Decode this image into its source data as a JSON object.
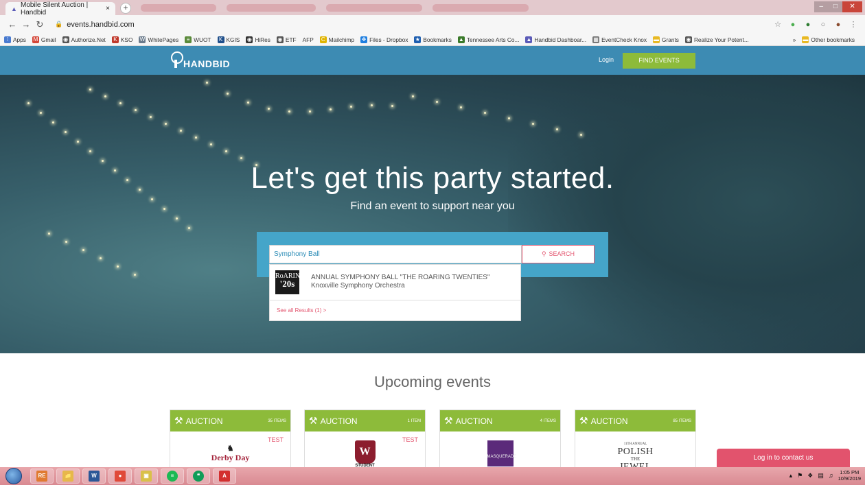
{
  "browser": {
    "active_tab_title": "Mobile Silent Auction | Handbid",
    "tab_close": "×",
    "new_tab": "+",
    "url": "events.handbid.com"
  },
  "bookmarks": [
    {
      "label": "Apps",
      "icon": "apps-grid-icon",
      "color": "#4a7bd0"
    },
    {
      "label": "Gmail",
      "icon": "gmail-icon",
      "color": "#d44638"
    },
    {
      "label": "Authorize.Net",
      "icon": "globe-icon",
      "color": "#555555"
    },
    {
      "label": "KSO",
      "icon": "kso-icon",
      "color": "#c0392b"
    },
    {
      "label": "WhitePages",
      "icon": "whitepages-icon",
      "color": "#6b7b8c"
    },
    {
      "label": "WUOT",
      "icon": "wuot-icon",
      "color": "#5a8a3a"
    },
    {
      "label": "KGIS",
      "icon": "kgis-icon",
      "color": "#1f4f8b"
    },
    {
      "label": "HiRes",
      "icon": "hires-icon",
      "color": "#333333"
    },
    {
      "label": "ETF",
      "icon": "globe-icon",
      "color": "#555555"
    },
    {
      "label": "AFP",
      "icon": "",
      "color": ""
    },
    {
      "label": "Mailchimp",
      "icon": "mailchimp-icon",
      "color": "#e0b400"
    },
    {
      "label": "Files - Dropbox",
      "icon": "dropbox-icon",
      "color": "#1f7fe0"
    },
    {
      "label": "Bookmarks",
      "icon": "star-icon",
      "color": "#1f5fb0"
    },
    {
      "label": "Tennessee Arts Co...",
      "icon": "tn-arts-icon",
      "color": "#3a7a2a"
    },
    {
      "label": "Handbid Dashboar...",
      "icon": "handbid-icon",
      "color": "#5b5bb8"
    },
    {
      "label": "EventCheck Knox",
      "icon": "calendar-icon",
      "color": "#777777"
    },
    {
      "label": "Grants",
      "icon": "folder-icon",
      "color": "#e8b923"
    },
    {
      "label": "Realize Your Potent...",
      "icon": "globe-icon",
      "color": "#555555"
    }
  ],
  "bookmarks_overflow": "»",
  "other_bookmarks": "Other bookmarks",
  "site": {
    "logo_text": "HANDBID",
    "login": "Login",
    "find_events": "FIND EVENTS"
  },
  "hero": {
    "title": "Let's get this party started.",
    "subtitle": "Find an event to support near you"
  },
  "search": {
    "value": "Symphony Ball",
    "button": "SEARCH",
    "result_thumb_line1": "RoARING",
    "result_thumb_line2": "'20s",
    "result_title": "ANNUAL SYMPHONY BALL \"THE ROARING TWENTIES\"",
    "result_org": "Knoxville Symphony Orchestra",
    "see_all": "See all Results (1) >"
  },
  "upcoming": {
    "title": "Upcoming events",
    "cards": [
      {
        "type": "AUCTION",
        "items": "35 ITEMS",
        "tag": "TEST",
        "logo": "Derby Day",
        "logo_glyph": "♞"
      },
      {
        "type": "AUCTION",
        "items": "1 ITEM",
        "tag": "TEST",
        "logo": "STUDENT",
        "logo_glyph": "W"
      },
      {
        "type": "AUCTION",
        "items": "4 ITEMS",
        "tag": "",
        "logo": "MASQUERADE",
        "logo_glyph": ""
      },
      {
        "type": "AUCTION",
        "items": "85 ITEMS",
        "tag": "",
        "logo_small": "11TH ANNUAL",
        "logo_big1": "POLISH",
        "logo_the": "THE",
        "logo_big2": "JEWEL"
      }
    ]
  },
  "contact_button": "Log in to contact us",
  "taskbar": {
    "apps": [
      {
        "name": "re-app",
        "label": "RE",
        "color": "#e07a30"
      },
      {
        "name": "file-explorer",
        "label": "📁",
        "color": "#e6b84a"
      },
      {
        "name": "word",
        "label": "W",
        "color": "#2b5797"
      },
      {
        "name": "chrome",
        "label": "●",
        "color": "#e04a3a"
      },
      {
        "name": "folder-app",
        "label": "▣",
        "color": "#d9c04a"
      },
      {
        "name": "spotify",
        "label": "≡",
        "color": "#1db954"
      },
      {
        "name": "hangouts",
        "label": "❝",
        "color": "#0f9d58"
      },
      {
        "name": "acrobat",
        "label": "A",
        "color": "#d32f2f"
      }
    ],
    "time": "1:05 PM",
    "date": "10/9/2019"
  }
}
